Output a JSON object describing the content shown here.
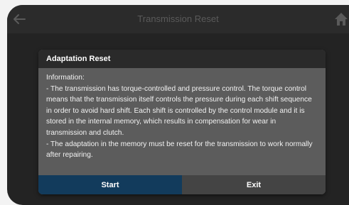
{
  "header": {
    "title": "Transmission Reset",
    "back_icon": "arrow-left-icon",
    "home_icon": "home-icon"
  },
  "dialog": {
    "title": "Adaptation Reset",
    "lines": [
      "Information:",
      "- The transmission has torque-controlled and pressure control. The torque control means that the transmission itself controls the pressure during each shift sequence in order to avoid hard shift. Each shift is controlled by the control module and it is stored in the internal memory, which results in compensation for wear in transmission and clutch.",
      "- The adaptation in the memory must be reset for the transmission to work normally after repairing."
    ],
    "start_label": "Start",
    "exit_label": "Exit"
  },
  "colors": {
    "start_button": "#123b5c",
    "exit_button": "#444444",
    "dialog_body": "#5c5c5c",
    "dialog_header": "#2a2a2a"
  }
}
